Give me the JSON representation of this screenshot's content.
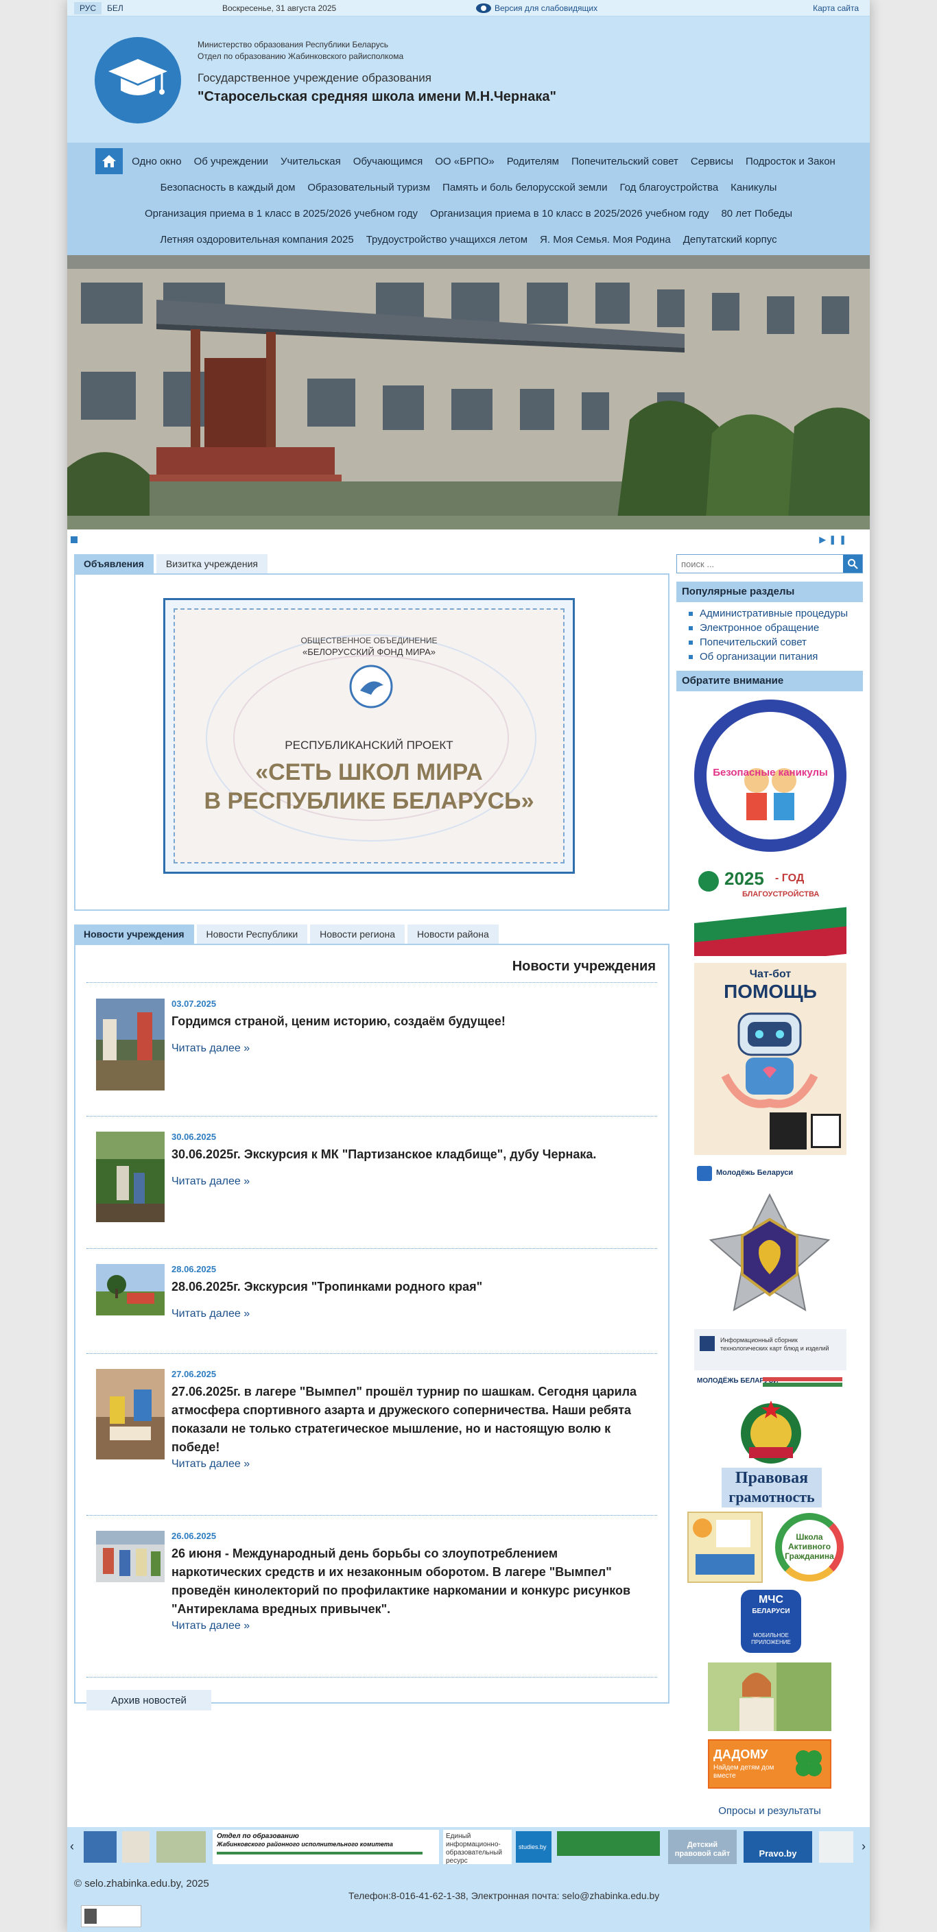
{
  "topbar": {
    "lang_ru": "РУС",
    "lang_be": "БЕЛ",
    "date": "Воскресенье, 31 августа 2025",
    "vision_label": "Версия для слабовидящих",
    "sitemap": "Карта сайта"
  },
  "header": {
    "line1": "Министерство образования Республики Беларусь",
    "line2": "Отдел по образованию Жабинковского райисполкома",
    "line3": "Государственное учреждение образования",
    "title": "\"Старосельская средняя школа имени М.Н.Чернака\""
  },
  "menu": {
    "row1": [
      "Одно окно",
      "Об учреждении",
      "Учительская",
      "Обучающимся",
      "ОО «БРПО»",
      "Родителям",
      "Попечительский совет",
      "Сервисы",
      "Подросток и Закон"
    ],
    "row2": [
      "Безопасность в каждый дом",
      "Образовательный туризм",
      "Память и боль белорусской земли",
      "Год благоустройства",
      "Каникулы"
    ],
    "row3": [
      "Организация приема в 1 класс в 2025/2026 учебном году",
      "Организация приема в 10 класс в 2025/2026 учебном году",
      "80 лет Победы"
    ],
    "row4": [
      "Летняя оздоровительная компания 2025",
      "Трудоустройство учащихся летом",
      "Я. Моя Семья. Моя Родина",
      "Депутатский корпус"
    ]
  },
  "tabs_top": [
    "Объявления",
    "Визитка учреждения"
  ],
  "certificate": {
    "org_line1": "ОБЩЕСТВЕННОЕ ОБЪЕДИНЕНИЕ",
    "org_line2": "«БЕЛОРУССКИЙ ФОНД МИРА»",
    "project": "РЕСПУБЛИКАНСКИЙ ПРОЕКТ",
    "title1": "«СЕТЬ ШКОЛ МИРА",
    "title2": "В РЕСПУБЛИКЕ БЕЛАРУСЬ»"
  },
  "tabs_news": [
    "Новости учреждения",
    "Новости Республики",
    "Новости региона",
    "Новости района"
  ],
  "news": {
    "title": "Новости учреждения",
    "read_more": "Читать далее »",
    "archive": "Архив новостей",
    "items": [
      {
        "date": "03.07.2025",
        "headline": "Гордимся страной, ценим историю, создаём будущее!"
      },
      {
        "date": "30.06.2025",
        "headline": "30.06.2025г. Экскурсия к МК \"Партизанское кладбище\", дубу Чернака."
      },
      {
        "date": "28.06.2025",
        "headline": "28.06.2025г. Экскурсия \"Тропинками родного края\""
      },
      {
        "date": "27.06.2025",
        "headline": "27.06.2025г. в лагере \"Вымпел\" прошёл турнир по шашкам. Сегодня царила атмосфера спортивного азарта и дружеского соперничества. Наши ребята показали не только стратегическое мышление, но и настоящую волю к победе!"
      },
      {
        "date": "26.06.2025",
        "headline": "26 июня - Международный день борьбы со злоупотреблением наркотических средств и их незаконным оборотом. В лагере \"Вымпел\" проведён кинолекторий по профилактике наркомании и конкурс рисунков \"Антиреклама вредных привычек\"."
      }
    ]
  },
  "sidebar": {
    "search_placeholder": "поиск ...",
    "popular_title": "Популярные разделы",
    "popular": [
      "Административные процедуры",
      "Электронное обращение",
      "Попечительский совет",
      "Об организации питания"
    ],
    "attention_title": "Обратите внимание",
    "banners": {
      "safe_holidays": "Безопасные каникулы",
      "year_2025": "2025",
      "year_suffix": "- ГОД",
      "year_text": "БЛАГОУСТРОЙСТВА",
      "chatbot_1": "Чат-бот",
      "chatbot_2": "ПОМОЩЬ",
      "youth": "Молодёжь Беларуси",
      "info_collection": "Информационный сборник технологических карт блюд и изделий",
      "youth2": "МОЛОДЁЖЬ БЕЛАРУСИ",
      "legal1": "Правовая",
      "legal2": "грамотность",
      "active_school": "Школа Активного Гражданина",
      "mchs1": "МЧС",
      "mchs2": "БЕЛАРУСИ",
      "mchs3": "МОБИЛЬНОЕ ПРИЛОЖЕНИЕ",
      "dadomu1": "ДАДОМУ",
      "dadomu2": "Найдем детям дом вместе"
    },
    "polls": "Опросы и результаты"
  },
  "strip": {
    "dept_title": "Отдел по образованию",
    "dept_sub": "Жабинковского районного исполнительного комитета",
    "info_resource": "Единый информационно-образовательный ресурс",
    "studies": "studies.by",
    "pravo": "Pravo.by",
    "kids": "Детский правовой сайт"
  },
  "footer": {
    "copyright": "© selo.zhabinka.edu.by, 2025",
    "contacts": "Телефон:8-016-41-62-1-38, Электронная почта: selo@zhabinka.edu.by"
  },
  "colors": {
    "accent": "#2e7dc1",
    "header_bg": "#c6e2f7",
    "menu_bg": "#a9cfed"
  }
}
